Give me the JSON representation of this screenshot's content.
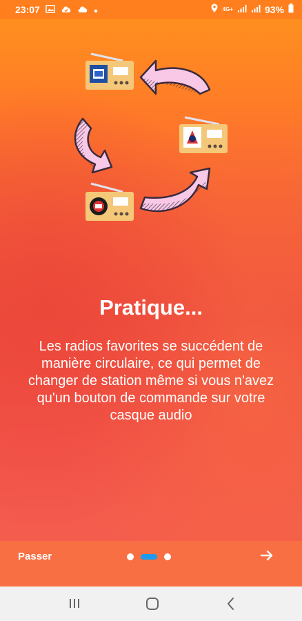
{
  "status_bar": {
    "time": "23:07",
    "network_type": "4G+",
    "battery_percent": "93%",
    "icons": [
      "image-icon",
      "cloud-check-icon",
      "cloud-icon",
      "dot-icon",
      "location-icon",
      "signal-icon",
      "signal-icon",
      "battery-icon"
    ]
  },
  "onboarding": {
    "title": "Pratique...",
    "description": "Les radios favorites se succédent de manière circulaire, ce qui permet de changer de station même si vous n'avez qu'un bouton de commande sur votre casque audio",
    "illustration": {
      "radios": [
        "france-info-radio",
        "virgin-radio",
        "mouv-radio"
      ],
      "arrow_color": "#f8c8e6",
      "radio_color": "#f4c779"
    }
  },
  "bottom_bar": {
    "skip_label": "Passer",
    "page_count": 3,
    "active_page": 2,
    "next_icon": "arrow-right-icon"
  },
  "nav_bar": {
    "buttons": [
      "recents-icon",
      "home-icon",
      "back-icon"
    ]
  },
  "colors": {
    "status_bar": "#ff7f1f",
    "bottom_bar": "#f86f43",
    "active_dot": "#1d9bf0",
    "text": "#ffffff"
  }
}
